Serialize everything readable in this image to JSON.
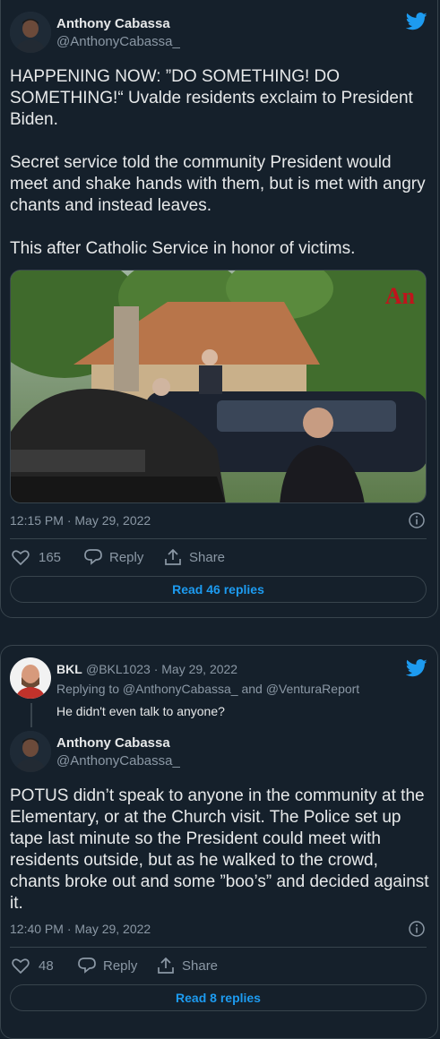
{
  "tweet1": {
    "author_name": "Anthony Cabassa",
    "author_handle": "@AnthonyCabassa_",
    "text": "HAPPENING NOW: ”DO SOMETHING! DO SOMETHING!“ Uvalde residents exclaim to President Biden.\n\nSecret service told the community President would meet and shake hands with them, but is met with angry chants and instead leaves.\n\nThis after Catholic Service in honor of victims.",
    "media_watermark": "An",
    "timestamp": "12:15 PM · May 29, 2022",
    "likes": "165",
    "reply_label": "Reply",
    "share_label": "Share",
    "read_replies": "Read 46 replies"
  },
  "tweet2": {
    "parent_name": "BKL",
    "parent_handle_date": "@BKL1023 · May 29, 2022",
    "replying_to": "Replying to @AnthonyCabassa_ and @VenturaReport",
    "parent_text": "He didn't even talk to anyone?",
    "author_name": "Anthony Cabassa",
    "author_handle": "@AnthonyCabassa_",
    "text": "POTUS didn’t speak to anyone in the community at the Elementary, or at the Church visit. The Police set up tape last minute so the President could meet with residents outside, but as he walked to the crowd, chants broke out and some ”boo’s” and decided against it.",
    "timestamp": "12:40 PM · May 29, 2022",
    "likes": "48",
    "reply_label": "Reply",
    "share_label": "Share",
    "read_replies": "Read 8 replies"
  },
  "colors": {
    "background": "#15202b",
    "accent": "#1d9bf0",
    "secondary_text": "#8b98a5",
    "border": "#38444d"
  },
  "icons": [
    "twitter-bird-icon",
    "heart-icon",
    "reply-icon",
    "share-icon",
    "info-icon"
  ]
}
